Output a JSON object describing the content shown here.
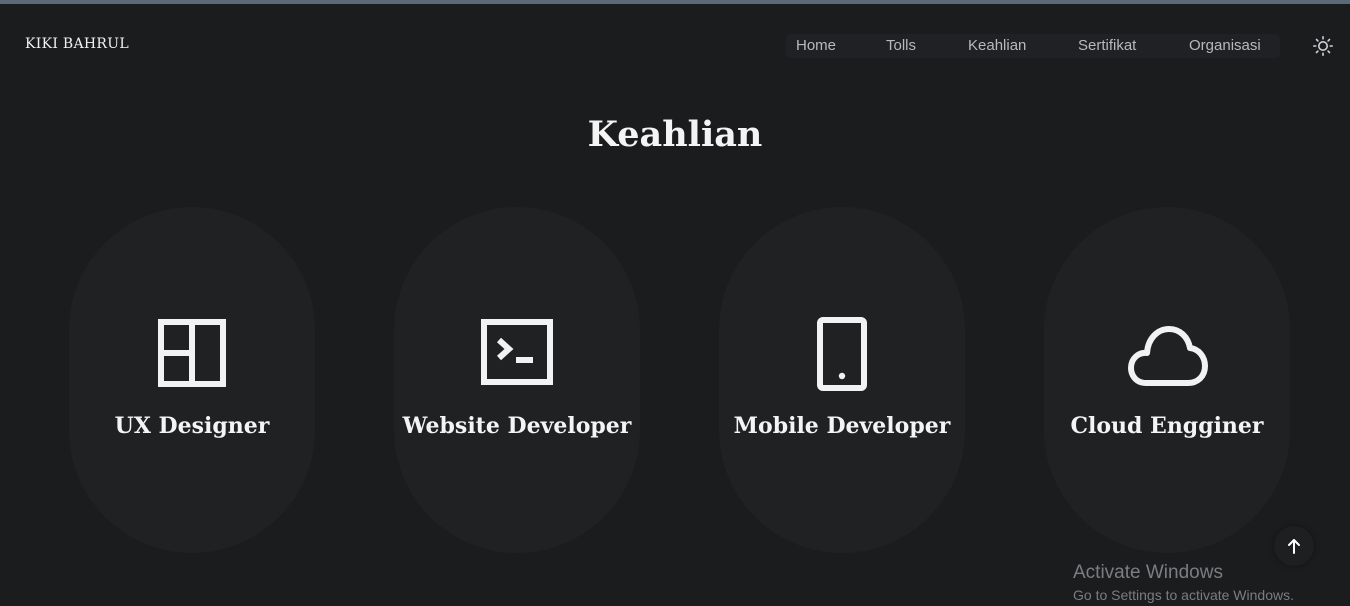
{
  "header": {
    "brand": "KIKI BAHRUL",
    "nav": [
      {
        "label": "Home"
      },
      {
        "label": "Tolls"
      },
      {
        "label": "Keahlian"
      },
      {
        "label": "Sertifikat"
      },
      {
        "label": "Organisasi"
      }
    ],
    "theme_toggle_icon": "sun-icon"
  },
  "section": {
    "title": "Keahlian",
    "cards": [
      {
        "label": "UX Designer",
        "icon": "layout-icon"
      },
      {
        "label": "Website Developer",
        "icon": "terminal-icon"
      },
      {
        "label": "Mobile Developer",
        "icon": "smartphone-icon"
      },
      {
        "label": "Cloud Engginer",
        "icon": "cloud-icon"
      }
    ]
  },
  "back_to_top_icon": "arrow-up-icon",
  "watermark": {
    "title": "Activate Windows",
    "subtitle": "Go to Settings to activate Windows."
  },
  "colors": {
    "background": "#1b1c1e",
    "card": "#202123",
    "text": "#f4f4f4",
    "nav_text": "#b7b9bd"
  }
}
